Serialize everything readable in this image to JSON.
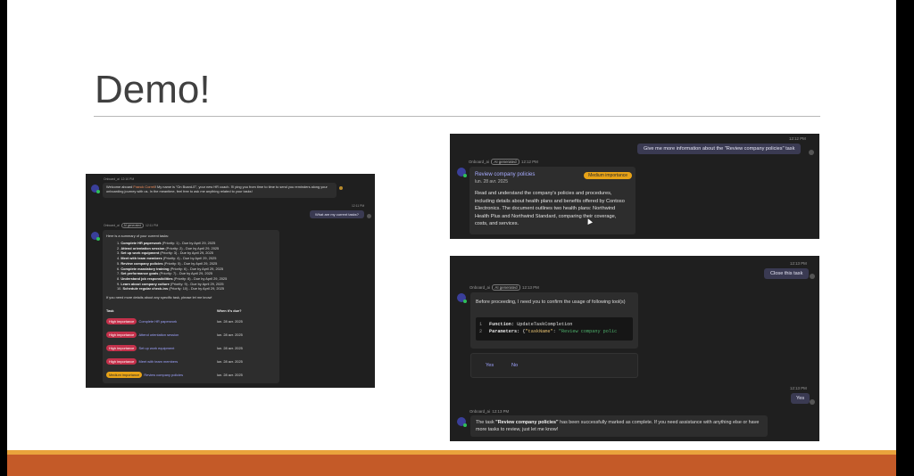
{
  "slide": {
    "title": "Demo!",
    "colors": {
      "background": "#ffffff",
      "title_text": "#404040",
      "footer_gold": "#e9a33c",
      "footer_orange": "#c45a28"
    }
  },
  "panel1": {
    "bot_name": "Onboard_ai",
    "welcome_time": "12:10 PM",
    "welcome_text_before": "Welcome aboard ",
    "welcome_name": "Franck Correll",
    "welcome_text_after": "! My name is \"On Board-E\", your new HR coach. I'll ping you from time to time to send you reminders along your onboarding journey with us. In the meantime, feel free to ask me anything related to your tasks!",
    "user_time": "12:11 PM",
    "user_message": "What are my current tasks?",
    "ai_generated_label": "AI generated",
    "reply_time": "12:11 PM",
    "summary_intro": "Here is a summary of your current tasks:",
    "tasks": [
      {
        "num": "1.",
        "name": "Complete HR paperwork",
        "detail": " (Priority: 1) - Due by April 29, 2025"
      },
      {
        "num": "2.",
        "name": "Attend orientation session",
        "detail": " (Priority: 2) - Due by April 29, 2025"
      },
      {
        "num": "3.",
        "name": "Set up work equipment",
        "detail": " (Priority: 3) - Due by April 29, 2025"
      },
      {
        "num": "4.",
        "name": "Meet with team members",
        "detail": " (Priority: 4) - Due by April 29, 2025"
      },
      {
        "num": "5.",
        "name": "Review company policies",
        "detail": " (Priority: 5) - Due by April 29, 2025"
      },
      {
        "num": "6.",
        "name": "Complete mandatory training",
        "detail": " (Priority: 6) - Due by April 29, 2025"
      },
      {
        "num": "7.",
        "name": "Set performance goals",
        "detail": " (Priority: 7) - Due by April 29, 2025"
      },
      {
        "num": "8.",
        "name": "Understand job responsibilities",
        "detail": " (Priority: 8) - Due by April 29, 2025"
      },
      {
        "num": "9.",
        "name": "Learn about company culture",
        "detail": " (Priority: 9) - Due by April 29, 2025"
      },
      {
        "num": "10.",
        "name": "Schedule regular check-ins",
        "detail": " (Priority: 10) - Due by April 29, 2025"
      }
    ],
    "details_prompt": "If you need more details about any specific task, please let me know!",
    "table_headers": {
      "task": "Task",
      "due": "When it's due?"
    },
    "table_rows": [
      {
        "importance": "High importance",
        "level": "high",
        "task": "Complete HR paperwork",
        "due": "lun. 28 avr. 2025"
      },
      {
        "importance": "High importance",
        "level": "high",
        "task": "Attend orientation session",
        "due": "lun. 28 avr. 2025"
      },
      {
        "importance": "High importance",
        "level": "high",
        "task": "Set up work equipment",
        "due": "lun. 28 avr. 2025"
      },
      {
        "importance": "High importance",
        "level": "high",
        "task": "Meet with team members",
        "due": "lun. 28 avr. 2025"
      },
      {
        "importance": "Medium importance",
        "level": "medium",
        "task": "Review company policies",
        "due": "lun. 28 avr. 2025"
      }
    ]
  },
  "panel2": {
    "user_time": "12:12 PM",
    "user_message": "Give me more information about the \"Review company policies\" task",
    "bot_name": "Onboard_ai",
    "ai_generated_label": "AI generated",
    "reply_time": "12:12 PM",
    "card_title": "Review company policies",
    "card_badge": "Medium importance",
    "card_date": "lun. 28 avr. 2025",
    "card_description": "Read and understand the company's policies and procedures, including details about health plans and benefits offered by Contoso Electronics. The document outlines two health plans: Northwind Health Plus and Northwind Standard, comparing their coverage, costs, and services."
  },
  "panel3": {
    "user_time": "12:13 PM",
    "user_message": "Close this task",
    "bot_name": "Onboard_ai",
    "ai_generated_label": "AI generated",
    "reply_time": "12:13 PM",
    "confirm_text": "Before proceeding, I need you to confirm the usage of following tool(s)",
    "code_line1_num": "1",
    "code_line1_key": "Function:",
    "code_line1_val": " UpdateTaskCompletion",
    "code_line2_num": "2",
    "code_line2_key": "Parameters:",
    "code_line2_brace": " {",
    "code_line2_param": "\"taskName\"",
    "code_line2_colon": ": ",
    "code_line2_value": "\"Review company polic",
    "yes_label": "Yes",
    "no_label": "No",
    "user2_time": "12:13 PM",
    "user2_message": "Yes",
    "final_time": "12:13 PM",
    "final_before": "The task ",
    "final_bold": "\"Review company policies\"",
    "final_after": " has been successfully marked as complete. If you need assistance with anything else or have more tasks to review, just let me know!"
  }
}
